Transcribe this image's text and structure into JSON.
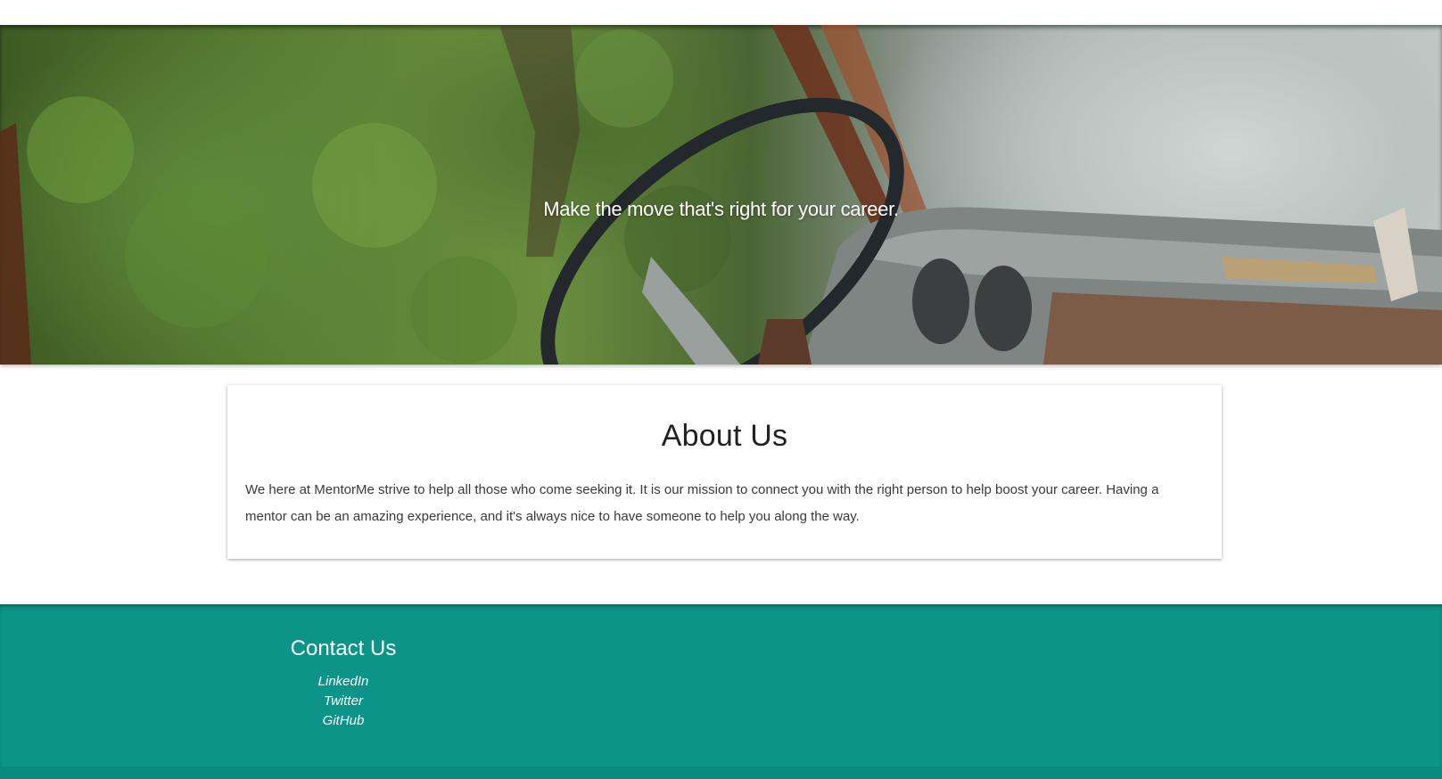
{
  "hero": {
    "tagline": "Make the move that's right for your career."
  },
  "about": {
    "title": "About Us",
    "body": "We here at MentorMe strive to help all those who come seeking it. It is our mission to connect you with the right person to help boost your career. Having a mentor can be an amazing experience, and it's always nice to have someone to help you along the way."
  },
  "footer": {
    "contact_title": "Contact Us",
    "links": [
      {
        "label": "LinkedIn"
      },
      {
        "label": "Twitter"
      },
      {
        "label": "GitHub"
      }
    ]
  },
  "colors": {
    "footer_background": "#0b9487",
    "footer_text": "#ffffff",
    "body_text": "#3a3a3a"
  }
}
